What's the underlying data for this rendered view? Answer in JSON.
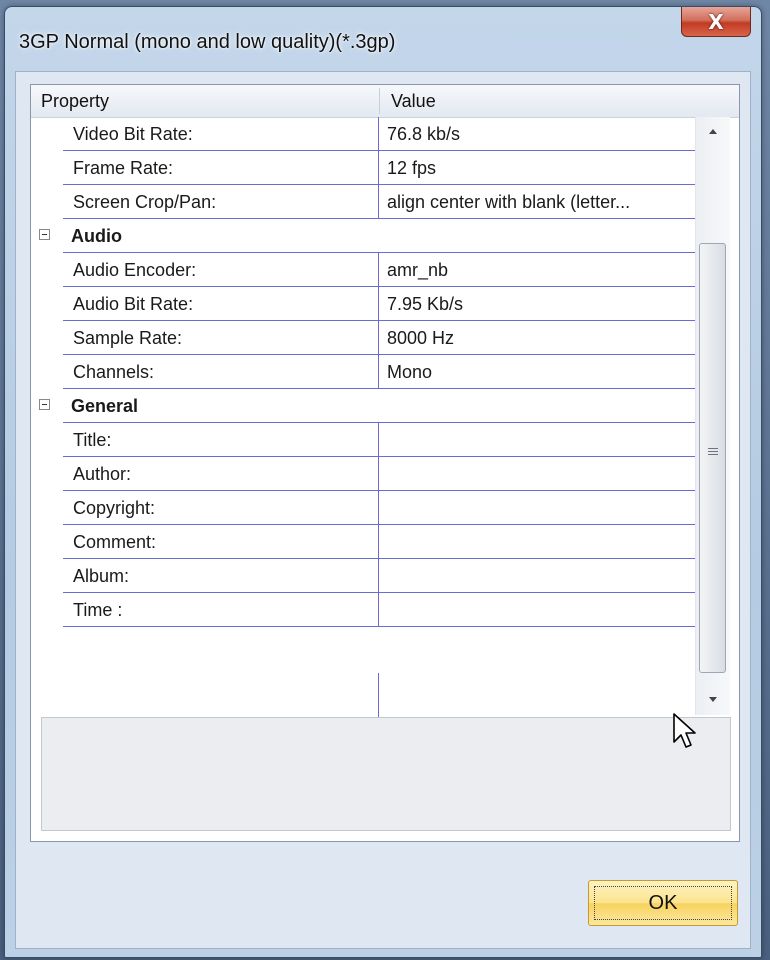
{
  "window": {
    "title": "3GP Normal (mono and low quality)(*.3gp)",
    "close_glyph": "X"
  },
  "grid": {
    "header": {
      "property": "Property",
      "value": "Value"
    },
    "rows": [
      {
        "type": "item",
        "name": "Video Bit Rate:",
        "value": "76.8 kb/s"
      },
      {
        "type": "item",
        "name": "Frame Rate:",
        "value": "12 fps"
      },
      {
        "type": "item",
        "name": "Screen Crop/Pan:",
        "value": "align center with blank (letter..."
      },
      {
        "type": "category",
        "name": "Audio"
      },
      {
        "type": "item",
        "name": "Audio Encoder:",
        "value": "amr_nb"
      },
      {
        "type": "item",
        "name": "Audio Bit Rate:",
        "value": "7.95 Kb/s"
      },
      {
        "type": "item",
        "name": "Sample Rate:",
        "value": "8000 Hz"
      },
      {
        "type": "item",
        "name": "Channels:",
        "value": "Mono"
      },
      {
        "type": "category",
        "name": "General"
      },
      {
        "type": "item",
        "name": "Title:",
        "value": ""
      },
      {
        "type": "item",
        "name": "Author:",
        "value": ""
      },
      {
        "type": "item",
        "name": "Copyright:",
        "value": ""
      },
      {
        "type": "item",
        "name": "Comment:",
        "value": ""
      },
      {
        "type": "item",
        "name": "Album:",
        "value": ""
      },
      {
        "type": "item",
        "name": "Time :",
        "value": ""
      }
    ]
  },
  "buttons": {
    "ok": "OK"
  },
  "icons": {
    "collapse": "minus-box-icon",
    "close": "close-icon",
    "cursor": "mouse-pointer-icon"
  },
  "colors": {
    "grid_line": "#6b6bd6",
    "ok_button": "#fbe38e",
    "close_button": "#c23b23"
  }
}
